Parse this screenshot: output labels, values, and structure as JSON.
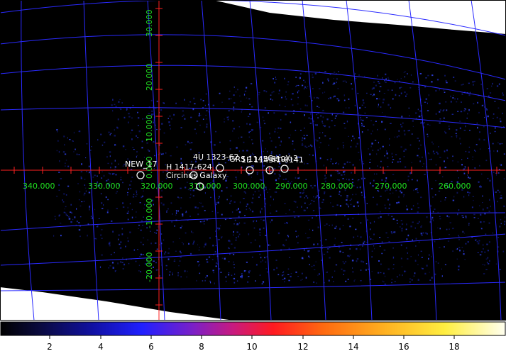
{
  "map": {
    "grid_color": "#2a2aff",
    "crosshair_color": "#ff2020",
    "label_color": "#20e020",
    "source_color": "#ffffff",
    "longitude_labels": [
      "340.000",
      "330.000",
      "320.000",
      "310.000",
      "300.000",
      "290.000",
      "280.000",
      "270.000",
      "260.000"
    ],
    "latitude_labels": [
      "30.000",
      "20.000",
      "10.000",
      "0.000",
      "-10.000",
      "-20.000"
    ],
    "sources": [
      {
        "name": "NEW_17"
      },
      {
        "name": "H 1417-624"
      },
      {
        "name": "Circinus Galaxy"
      },
      {
        "name": "4U 1323-62"
      },
      {
        "name": "GRS 1145-619"
      },
      {
        "name": "Cen X-3"
      },
      {
        "name": "1E 1145.1-6141"
      }
    ]
  },
  "colorbar": {
    "tick_labels": [
      "2",
      "4",
      "6",
      "8",
      "10",
      "12",
      "14",
      "16",
      "18"
    ],
    "colormap": "cubehelix-like: black-blue-purple-red-orange-yellow-white"
  }
}
